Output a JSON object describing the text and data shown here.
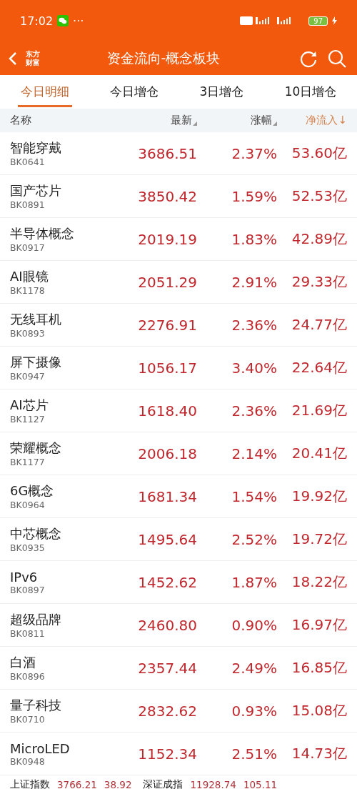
{
  "status_bar": {
    "time": "17:02",
    "dots": "···",
    "battery": "97"
  },
  "header": {
    "logo_top": "东方",
    "logo_bottom": "财富",
    "title": "资金流向-概念板块"
  },
  "tabs": [
    {
      "label": "今日明细",
      "selected": true
    },
    {
      "label": "今日增仓",
      "selected": false
    },
    {
      "label": "3日增仓",
      "selected": false
    },
    {
      "label": "10日增仓",
      "selected": false
    }
  ],
  "table": {
    "columns": [
      {
        "label": "名称",
        "sorted": false
      },
      {
        "label": "最新",
        "sorted": false
      },
      {
        "label": "涨幅",
        "sorted": false
      },
      {
        "label": "净流入↓",
        "sorted": true
      }
    ],
    "rows": [
      {
        "name": "智能穿戴",
        "code": "BK0641",
        "latest": "3686.51",
        "change": "2.37%",
        "inflow": "53.60亿"
      },
      {
        "name": "国产芯片",
        "code": "BK0891",
        "latest": "3850.42",
        "change": "1.59%",
        "inflow": "52.53亿"
      },
      {
        "name": "半导体概念",
        "code": "BK0917",
        "latest": "2019.19",
        "change": "1.83%",
        "inflow": "42.89亿"
      },
      {
        "name": "AI眼镜",
        "code": "BK1178",
        "latest": "2051.29",
        "change": "2.91%",
        "inflow": "29.33亿"
      },
      {
        "name": "无线耳机",
        "code": "BK0893",
        "latest": "2276.91",
        "change": "2.36%",
        "inflow": "24.77亿"
      },
      {
        "name": "屏下摄像",
        "code": "BK0947",
        "latest": "1056.17",
        "change": "3.40%",
        "inflow": "22.64亿"
      },
      {
        "name": "AI芯片",
        "code": "BK1127",
        "latest": "1618.40",
        "change": "2.36%",
        "inflow": "21.69亿"
      },
      {
        "name": "荣耀概念",
        "code": "BK1177",
        "latest": "2006.18",
        "change": "2.14%",
        "inflow": "20.41亿"
      },
      {
        "name": "6G概念",
        "code": "BK0964",
        "latest": "1681.34",
        "change": "1.54%",
        "inflow": "19.92亿"
      },
      {
        "name": "中芯概念",
        "code": "BK0935",
        "latest": "1495.64",
        "change": "2.52%",
        "inflow": "19.72亿"
      },
      {
        "name": "IPv6",
        "code": "BK0897",
        "latest": "1452.62",
        "change": "1.87%",
        "inflow": "18.22亿"
      },
      {
        "name": "超级品牌",
        "code": "BK0811",
        "latest": "2460.80",
        "change": "0.90%",
        "inflow": "16.97亿"
      },
      {
        "name": "白酒",
        "code": "BK0896",
        "latest": "2357.44",
        "change": "2.49%",
        "inflow": "16.85亿"
      },
      {
        "name": "量子科技",
        "code": "BK0710",
        "latest": "2832.62",
        "change": "0.93%",
        "inflow": "15.08亿"
      },
      {
        "name": "MicroLED",
        "code": "BK0948",
        "latest": "1152.34",
        "change": "2.51%",
        "inflow": "14.73亿"
      }
    ]
  },
  "index_bar": [
    {
      "name": "上证指数",
      "value": "3766.21",
      "change": "38.92"
    },
    {
      "name": "深证成指",
      "value": "11928.74",
      "change": "105.11"
    }
  ]
}
